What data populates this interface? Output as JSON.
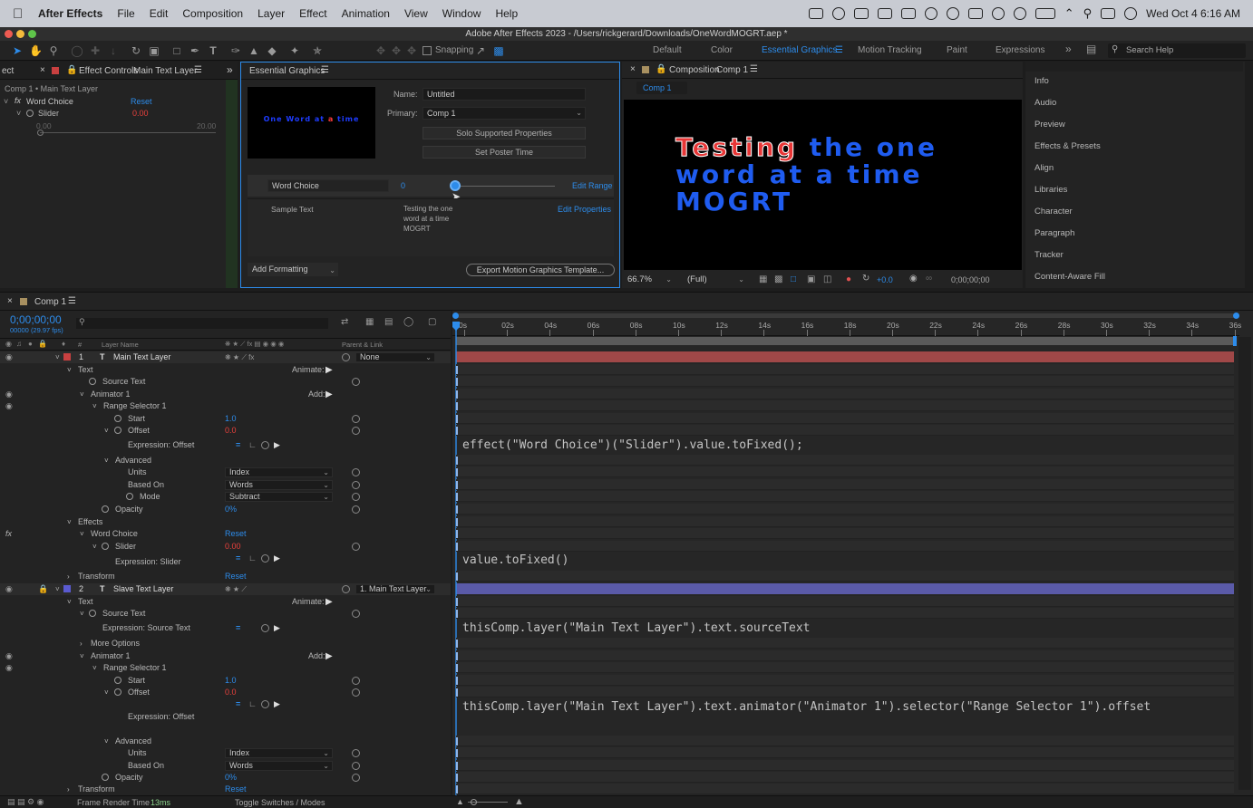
{
  "menubar": {
    "app": "After Effects",
    "items": [
      "File",
      "Edit",
      "Composition",
      "Layer",
      "Effect",
      "Animation",
      "View",
      "Window",
      "Help"
    ],
    "clock": "Wed Oct 4  6:16 AM"
  },
  "window_title": "Adobe After Effects 2023 - /Users/rickgerard/Downloads/OneWordMOGRT.aep *",
  "toolbar": {
    "snapping": "Snapping",
    "workspaces": [
      "Default",
      "Color",
      "Essential Graphics",
      "Motion Tracking",
      "Paint",
      "Expressions"
    ],
    "active_workspace": "Essential Graphics",
    "search_placeholder": "Search Help"
  },
  "effect_controls": {
    "tab_prefix": "ect",
    "tab_label": "Effect Controls",
    "tab_layer": "Main Text Layer",
    "breadcrumb": "Comp 1 • Main Text Layer",
    "effect_name": "Word Choice",
    "reset": "Reset",
    "slider_label": "Slider",
    "slider_value": "0.00",
    "range_min": "0.00",
    "range_max": "20.00"
  },
  "essential_graphics": {
    "tab": "Essential Graphics",
    "preview_text_a": "One Word at ",
    "preview_text_b": "a",
    "preview_text_c": " time",
    "name_label": "Name:",
    "name_value": "Untitled",
    "primary_label": "Primary:",
    "primary_value": "Comp 1",
    "solo_button": "Solo Supported Properties",
    "poster_button": "Set Poster Time",
    "word_choice_field": "Word Choice",
    "word_choice_value": "0",
    "edit_range": "Edit Range",
    "sample_label": "Sample Text",
    "sample_value_1": "Testing the one",
    "sample_value_2": "word at a time",
    "sample_value_3": "MOGRT",
    "edit_properties": "Edit Properties",
    "add_formatting": "Add Formatting",
    "export_button": "Export Motion Graphics Template..."
  },
  "composition": {
    "tab_label": "Composition",
    "tab_comp": "Comp 1",
    "subtab": "Comp 1",
    "line1_red": "Testing",
    "line1_blue": " the one",
    "line2": "word at a time",
    "line3": "MOGRT",
    "zoom": "66.7%",
    "resolution": "(Full)",
    "exposure": "+0.0",
    "timecode": "0;00;00;00"
  },
  "right_panel": {
    "items": [
      "Info",
      "Audio",
      "Preview",
      "Effects & Presets",
      "Align",
      "Libraries",
      "Character",
      "Paragraph",
      "Tracker",
      "Content-Aware Fill"
    ]
  },
  "timeline": {
    "tab": "Comp 1",
    "timecode": "0;00;00;00",
    "fps": "00000 (29.97 fps)",
    "col_layer_name": "Layer Name",
    "col_number": "#",
    "col_parent": "Parent & Link",
    "ruler": [
      "0s",
      "02s",
      "04s",
      "06s",
      "08s",
      "10s",
      "12s",
      "14s",
      "16s",
      "18s",
      "20s",
      "22s",
      "24s",
      "26s",
      "28s",
      "30s",
      "32s",
      "34s",
      "36s"
    ],
    "layer1_num": "1",
    "layer1_name": "Main Text Layer",
    "layer1_parent": "None",
    "layer2_num": "2",
    "layer2_name": "Slave Text Layer",
    "layer2_parent": "1. Main Text Layer",
    "text": "Text",
    "animate": "Animate:",
    "add": "Add:",
    "source_text": "Source Text",
    "animator1": "Animator 1",
    "range_selector": "Range Selector 1",
    "start": "Start",
    "start_val": "1.0",
    "offset": "Offset",
    "offset_val": "0.0",
    "expr_offset": "Expression: Offset",
    "advanced": "Advanced",
    "units": "Units",
    "units_val": "Index",
    "based_on": "Based On",
    "based_on_val": "Words",
    "mode": "Mode",
    "mode_val": "Subtract",
    "opacity": "Opacity",
    "opacity_val": "0%",
    "effects": "Effects",
    "word_choice": "Word Choice",
    "reset": "Reset",
    "slider": "Slider",
    "slider_val": "0.00",
    "expr_slider": "Expression: Slider",
    "transform": "Transform",
    "expr_source": "Expression: Source Text",
    "more_options": "More Options",
    "expressions": [
      "effect(\"Word Choice\")(\"Slider\").value.toFixed();",
      "value.toFixed()",
      "thisComp.layer(\"Main Text Layer\").text.sourceText",
      "thisComp.layer(\"Main Text Layer\").text.animator(\"Animator 1\").selector(\"Range Selector 1\").offset"
    ],
    "render_label": "Frame Render Time",
    "render_time": "13ms",
    "toggle": "Toggle Switches / Modes"
  },
  "colors": {
    "accent": "#2d8ceb",
    "value_red": "#e8403c",
    "layer1_bar": "#a04848",
    "layer2_bar": "#5a5aa8"
  }
}
